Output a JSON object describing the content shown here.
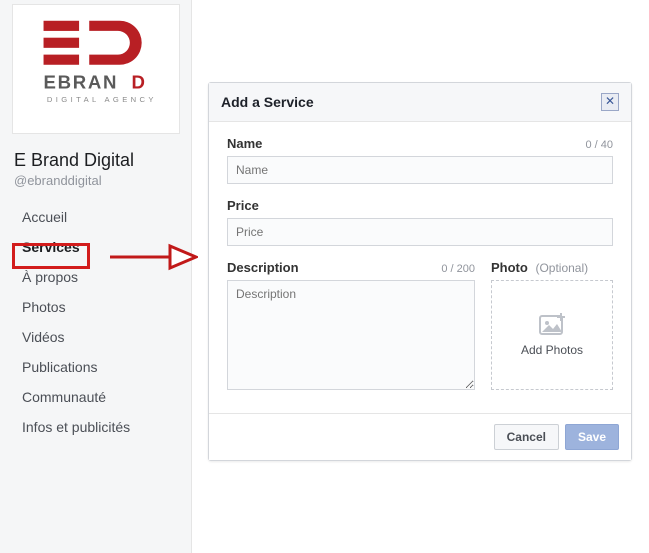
{
  "sidebar": {
    "page_name": "E Brand Digital",
    "handle": "@ebranddigital",
    "items": [
      {
        "label": "Accueil"
      },
      {
        "label": "Services"
      },
      {
        "label": "À propos"
      },
      {
        "label": "Photos"
      },
      {
        "label": "Vidéos"
      },
      {
        "label": "Publications"
      },
      {
        "label": "Communauté"
      },
      {
        "label": "Infos et publicités"
      }
    ],
    "active_index": 1
  },
  "dialog": {
    "title": "Add a Service",
    "name": {
      "label": "Name",
      "counter": "0 / 40",
      "placeholder": "Name",
      "value": ""
    },
    "price": {
      "label": "Price",
      "placeholder": "Price",
      "value": ""
    },
    "description": {
      "label": "Description",
      "counter": "0 / 200",
      "placeholder": "Description",
      "value": ""
    },
    "photo": {
      "label": "Photo",
      "optional": "(Optional)",
      "drop_text": "Add Photos"
    },
    "buttons": {
      "cancel": "Cancel",
      "save": "Save"
    }
  },
  "colors": {
    "brand_red": "#b81f24",
    "fb_blue": "#9db3dd"
  }
}
